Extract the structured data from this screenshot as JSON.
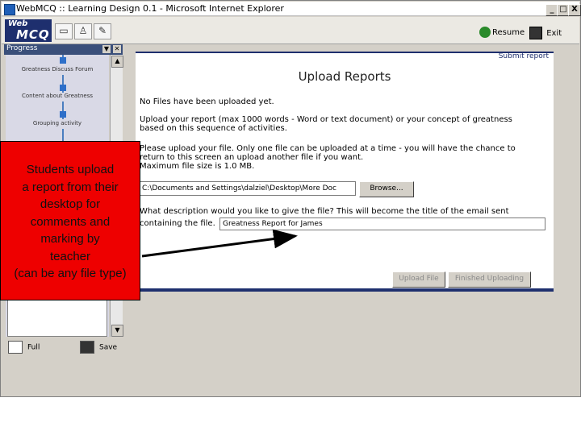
{
  "window": {
    "title": "WebMCQ :: Learning Design 0.1 - Microsoft Internet Explorer",
    "min": "_",
    "max": "□",
    "close": "X"
  },
  "toolbar": {
    "logo_top": "Web",
    "logo_main": "MCQ",
    "resume_label": "Resume",
    "exit_label": "Exit"
  },
  "sidebar": {
    "header": "Progress",
    "steps": [
      {
        "label": "Greatness Discuss Forum"
      },
      {
        "label": "Content about Greatness"
      },
      {
        "label": "Grouping activity"
      }
    ],
    "full_label": "Full",
    "save_label": "Save"
  },
  "content": {
    "tab_label": "Submit report",
    "title": "Upload Reports",
    "no_files": "No Files have been uploaded yet.",
    "instruction_1": "Upload your report (max 1000 words - Word or text document) or your concept of greatness",
    "instruction_2": "based on this sequence of activities.",
    "upload_1": "Please upload your file. Only one file can be uploaded at a time - you will have the chance to",
    "upload_2": "return to this screen an upload another file if you want.",
    "upload_3": "Maximum file size is 1.0 MB.",
    "file_path": "C:\\Documents and Settings\\dalziel\\Desktop\\More Doc",
    "browse_label": "Browse...",
    "desc_q1": "What description would you like to give the file? This will become the title of the email sent",
    "desc_q2": "containing the file.",
    "desc_value": "Greatness Report for James",
    "upload_btn": "Upload File",
    "finished_btn": "Finished Uploading"
  },
  "annotation": {
    "lines": [
      "Students upload",
      "a report from their",
      "desktop for",
      "comments and",
      "marking by",
      "teacher",
      "(can be any file type)"
    ],
    "color": "#ee0000"
  }
}
